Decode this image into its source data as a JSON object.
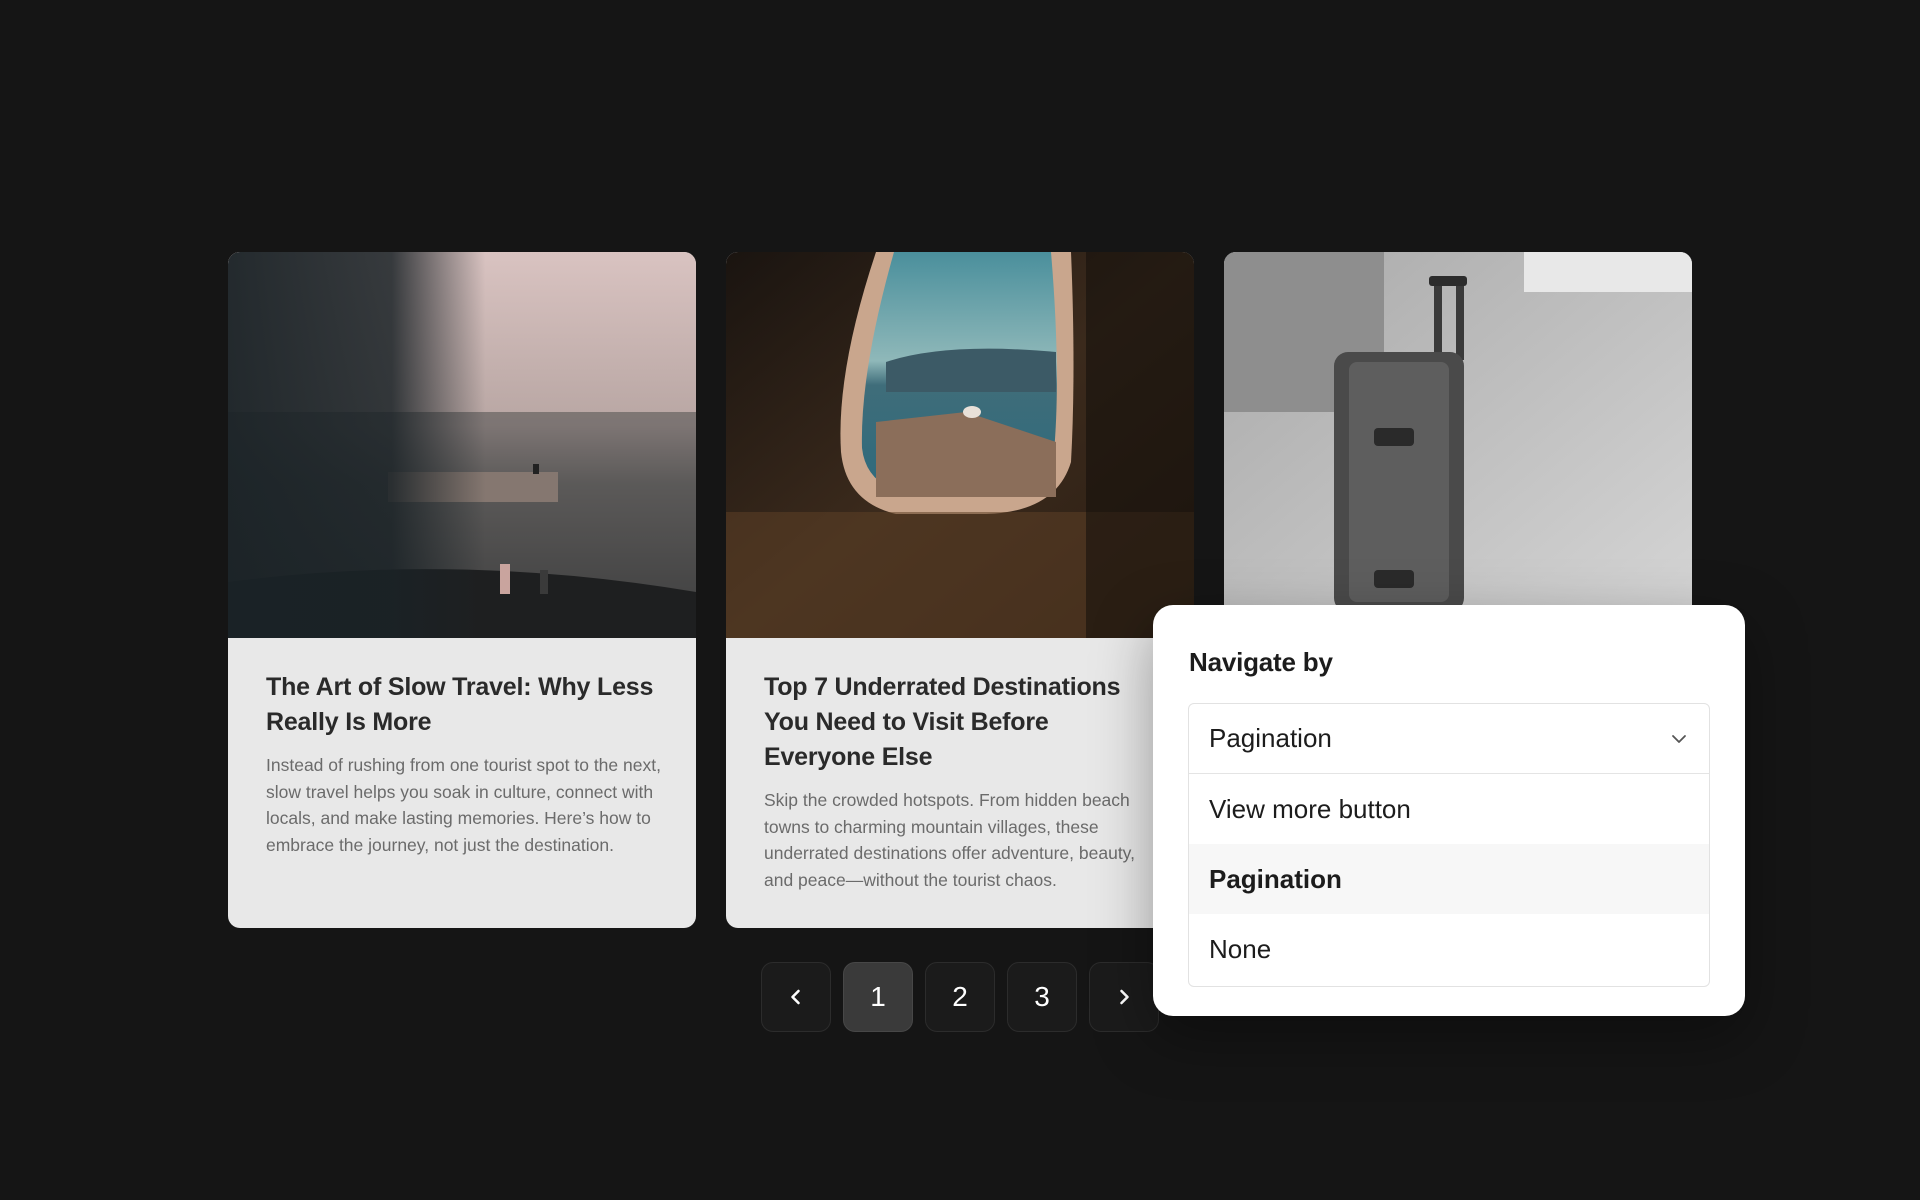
{
  "cards": [
    {
      "title": "The Art of Slow Travel: Why Less Really Is More",
      "excerpt": "Instead of rushing from one tourist spot to the next, slow travel helps you soak in culture, connect with locals, and make lasting memories. Here’s how to embrace the journey, not just the destination.",
      "image": "beach-scene"
    },
    {
      "title": "Top 7 Underrated Destinations You Need to Visit Before Everyone Else",
      "excerpt": "Skip the crowded hotspots. From hidden beach towns to charming mountain villages, these underrated destinations offer adventure, beauty, and peace—without the tourist chaos.",
      "image": "window-sea-view"
    },
    {
      "title": "",
      "excerpt": "",
      "image": "suitcase"
    }
  ],
  "pagination": {
    "prev_icon": "chevron-left-icon",
    "next_icon": "chevron-right-icon",
    "pages": [
      "1",
      "2",
      "3"
    ],
    "current": "1"
  },
  "navigate_panel": {
    "title": "Navigate by",
    "selected": "Pagination",
    "dropdown_icon": "chevron-down-icon",
    "options": [
      "View more button",
      "Pagination",
      "None"
    ]
  },
  "colors": {
    "background": "#151515",
    "card": "#e8e8e8",
    "panel": "#ffffff",
    "active_page": "#3a3a3a"
  }
}
